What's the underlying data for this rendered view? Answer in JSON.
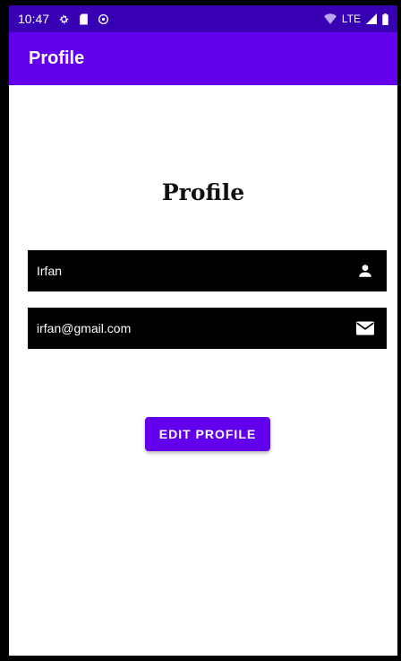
{
  "status_bar": {
    "time": "10:47",
    "network": "LTE",
    "left_icons": [
      "gear-icon",
      "sd-card-icon",
      "data-saver-icon"
    ],
    "right_icons": [
      "wifi-icon",
      "signal-icon",
      "battery-icon"
    ]
  },
  "app_bar": {
    "title": "Profile"
  },
  "profile": {
    "heading": "Profile",
    "name_field": {
      "value": "Irfan",
      "icon": "person-icon"
    },
    "email_field": {
      "value": "irfan@gmail.com",
      "icon": "mail-icon"
    },
    "edit_button_label": "EDIT PROFILE"
  },
  "colors": {
    "status_bar": "#3700B3",
    "primary": "#6200EE",
    "field_background": "#000000"
  }
}
